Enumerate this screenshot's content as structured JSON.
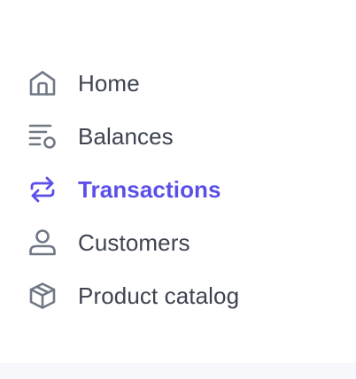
{
  "sidebar": {
    "items": [
      {
        "key": "home",
        "label": "Home",
        "icon": "home-icon",
        "active": false
      },
      {
        "key": "balances",
        "label": "Balances",
        "icon": "balances-icon",
        "active": false
      },
      {
        "key": "transactions",
        "label": "Transactions",
        "icon": "arrows-swap-icon",
        "active": true
      },
      {
        "key": "customers",
        "label": "Customers",
        "icon": "person-icon",
        "active": false
      },
      {
        "key": "product-catalog",
        "label": "Product catalog",
        "icon": "box-icon",
        "active": false
      }
    ]
  },
  "colors": {
    "text": "#3d4350",
    "icon": "#717885",
    "active": "#5b4fe9"
  }
}
